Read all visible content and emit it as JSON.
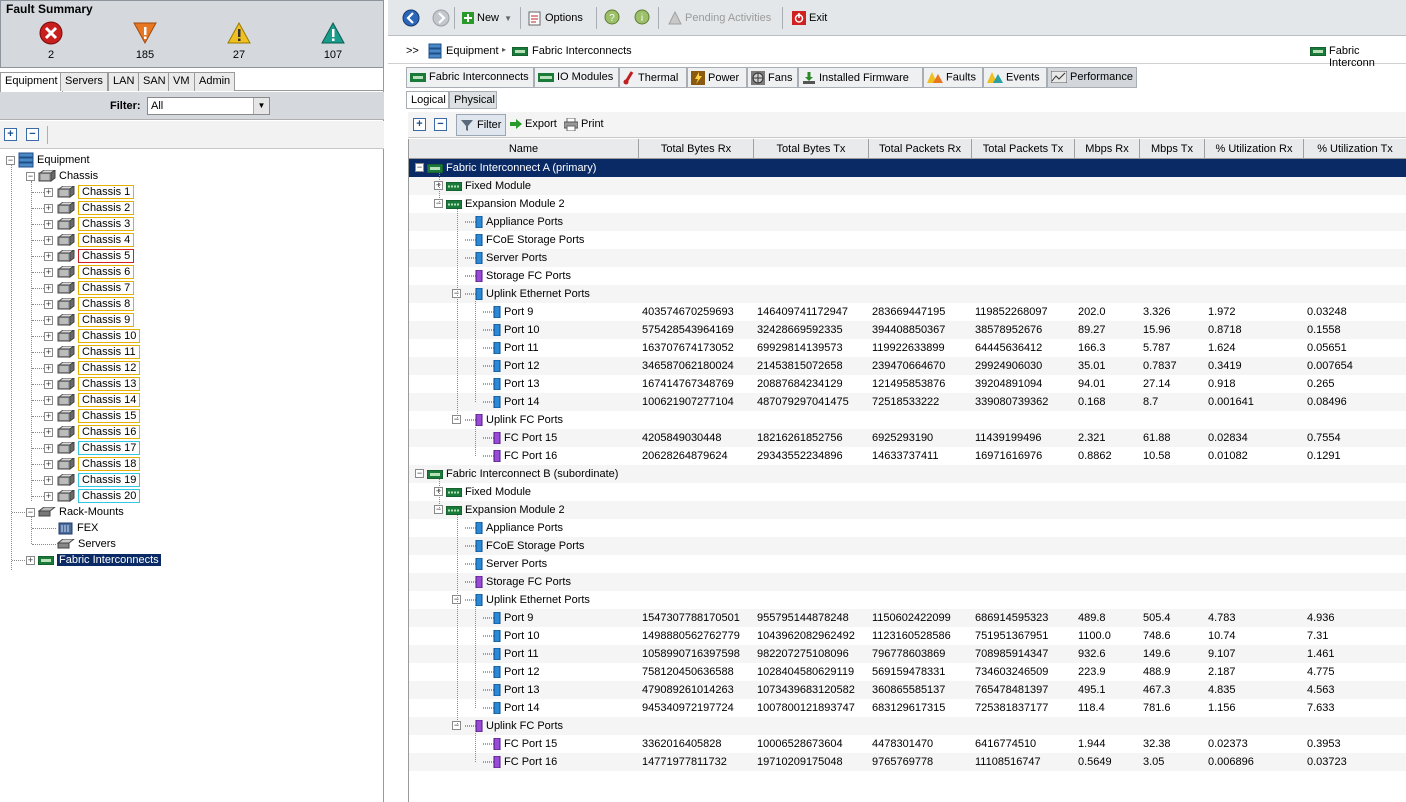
{
  "fault_summary": {
    "title": "Fault Summary",
    "critical": "2",
    "major": "185",
    "minor": "27",
    "warning": "107"
  },
  "nav_tabs": [
    "Equipment",
    "Servers",
    "LAN",
    "SAN",
    "VM",
    "Admin"
  ],
  "filter": {
    "label": "Filter:",
    "value": "All"
  },
  "tree": {
    "root": "Equipment",
    "chassis_label": "Chassis",
    "chassis": [
      "Chassis 1",
      "Chassis 2",
      "Chassis 3",
      "Chassis 4",
      "Chassis 5",
      "Chassis 6",
      "Chassis 7",
      "Chassis 8",
      "Chassis 9",
      "Chassis 10",
      "Chassis 11",
      "Chassis 12",
      "Chassis 13",
      "Chassis 14",
      "Chassis 15",
      "Chassis 16",
      "Chassis 17",
      "Chassis 18",
      "Chassis 19",
      "Chassis 20"
    ],
    "rack_mounts": "Rack-Mounts",
    "fex": "FEX",
    "servers": "Servers",
    "fabric_interconnects": "Fabric Interconnects"
  },
  "toolbar": {
    "new": "New",
    "options": "Options",
    "pending": "Pending Activities",
    "exit": "Exit"
  },
  "breadcrumb": {
    "prefix": ">>",
    "equipment": "Equipment",
    "fabric": "Fabric Interconnects",
    "right": "Fabric Interconn"
  },
  "content_tabs": [
    "Fabric Interconnects",
    "IO Modules",
    "Thermal",
    "Power",
    "Fans",
    "Installed Firmware",
    "Faults",
    "Events",
    "Performance"
  ],
  "view_tabs": [
    "Logical",
    "Physical"
  ],
  "perf_toolbar": {
    "filter": "Filter",
    "export": "Export",
    "print": "Print"
  },
  "columns": [
    "Name",
    "Total Bytes Rx",
    "Total Bytes Tx",
    "Total Packets Rx",
    "Total Packets Tx",
    "Mbps Rx",
    "Mbps Tx",
    "% Utilization Rx",
    "% Utilization Tx"
  ],
  "rows": [
    {
      "level": 0,
      "toggle": "-",
      "icon": "fi",
      "name": "Fabric Interconnect A (primary)",
      "selected": true,
      "values": []
    },
    {
      "level": 1,
      "toggle": "+",
      "icon": "fm",
      "name": "Fixed Module",
      "values": []
    },
    {
      "level": 1,
      "toggle": "-",
      "icon": "fm",
      "name": "Expansion Module 2",
      "values": []
    },
    {
      "level": 2,
      "toggle": "",
      "icon": "port-blue",
      "name": "Appliance Ports",
      "values": []
    },
    {
      "level": 2,
      "toggle": "",
      "icon": "port-blue",
      "name": "FCoE Storage Ports",
      "values": []
    },
    {
      "level": 2,
      "toggle": "",
      "icon": "port-blue",
      "name": "Server Ports",
      "values": []
    },
    {
      "level": 2,
      "toggle": "",
      "icon": "port-purple",
      "name": "Storage FC Ports",
      "values": []
    },
    {
      "level": 2,
      "toggle": "-",
      "icon": "port-blue",
      "name": "Uplink Ethernet Ports",
      "values": []
    },
    {
      "level": 3,
      "toggle": "",
      "icon": "port-blue",
      "name": "Port 9",
      "values": [
        "403574670259693",
        "146409741172947",
        "283669447195",
        "119852268097",
        "202.0",
        "3.326",
        "1.972",
        "0.03248"
      ]
    },
    {
      "level": 3,
      "toggle": "",
      "icon": "port-blue",
      "name": "Port 10",
      "values": [
        "575428543964169",
        "32428669592335",
        "394408850367",
        "38578952676",
        "89.27",
        "15.96",
        "0.8718",
        "0.1558"
      ]
    },
    {
      "level": 3,
      "toggle": "",
      "icon": "port-blue",
      "name": "Port 11",
      "values": [
        "163707674173052",
        "69929814139573",
        "119922633899",
        "64445636412",
        "166.3",
        "5.787",
        "1.624",
        "0.05651"
      ]
    },
    {
      "level": 3,
      "toggle": "",
      "icon": "port-blue",
      "name": "Port 12",
      "values": [
        "346587062180024",
        "21453815072658",
        "239470664670",
        "29924906030",
        "35.01",
        "0.7837",
        "0.3419",
        "0.007654"
      ]
    },
    {
      "level": 3,
      "toggle": "",
      "icon": "port-blue",
      "name": "Port 13",
      "values": [
        "167414767348769",
        "20887684234129",
        "121495853876",
        "39204891094",
        "94.01",
        "27.14",
        "0.918",
        "0.265"
      ]
    },
    {
      "level": 3,
      "toggle": "",
      "icon": "port-blue",
      "name": "Port 14",
      "values": [
        "100621907277104",
        "487079297041475",
        "72518533222",
        "339080739362",
        "0.168",
        "8.7",
        "0.001641",
        "0.08496"
      ]
    },
    {
      "level": 2,
      "toggle": "-",
      "icon": "port-purple",
      "name": "Uplink FC Ports",
      "values": []
    },
    {
      "level": 3,
      "toggle": "",
      "icon": "port-purple",
      "name": "FC Port 15",
      "values": [
        "4205849030448",
        "18216261852756",
        "6925293190",
        "11439199496",
        "2.321",
        "61.88",
        "0.02834",
        "0.7554"
      ]
    },
    {
      "level": 3,
      "toggle": "",
      "icon": "port-purple",
      "name": "FC Port 16",
      "values": [
        "20628264879624",
        "29343552234896",
        "14633737411",
        "16971616976",
        "0.8862",
        "10.58",
        "0.01082",
        "0.1291"
      ]
    },
    {
      "level": 0,
      "toggle": "-",
      "icon": "fi",
      "name": "Fabric Interconnect B (subordinate)",
      "values": []
    },
    {
      "level": 1,
      "toggle": "+",
      "icon": "fm",
      "name": "Fixed Module",
      "values": []
    },
    {
      "level": 1,
      "toggle": "-",
      "icon": "fm",
      "name": "Expansion Module 2",
      "values": []
    },
    {
      "level": 2,
      "toggle": "",
      "icon": "port-blue",
      "name": "Appliance Ports",
      "values": []
    },
    {
      "level": 2,
      "toggle": "",
      "icon": "port-blue",
      "name": "FCoE Storage Ports",
      "values": []
    },
    {
      "level": 2,
      "toggle": "",
      "icon": "port-blue",
      "name": "Server Ports",
      "values": []
    },
    {
      "level": 2,
      "toggle": "",
      "icon": "port-purple",
      "name": "Storage FC Ports",
      "values": []
    },
    {
      "level": 2,
      "toggle": "-",
      "icon": "port-blue",
      "name": "Uplink Ethernet Ports",
      "values": []
    },
    {
      "level": 3,
      "toggle": "",
      "icon": "port-blue",
      "name": "Port 9",
      "values": [
        "1547307788170501",
        "955795144878248",
        "1150602422099",
        "686914595323",
        "489.8",
        "505.4",
        "4.783",
        "4.936"
      ]
    },
    {
      "level": 3,
      "toggle": "",
      "icon": "port-blue",
      "name": "Port 10",
      "values": [
        "1498880562762779",
        "1043962082962492",
        "1123160528586",
        "751951367951",
        "1100.0",
        "748.6",
        "10.74",
        "7.31"
      ]
    },
    {
      "level": 3,
      "toggle": "",
      "icon": "port-blue",
      "name": "Port 11",
      "values": [
        "1058990716397598",
        "982207275108096",
        "796778603869",
        "708985914347",
        "932.6",
        "149.6",
        "9.107",
        "1.461"
      ]
    },
    {
      "level": 3,
      "toggle": "",
      "icon": "port-blue",
      "name": "Port 12",
      "values": [
        "758120450636588",
        "1028404580629119",
        "569159478331",
        "734603246509",
        "223.9",
        "488.9",
        "2.187",
        "4.775"
      ]
    },
    {
      "level": 3,
      "toggle": "",
      "icon": "port-blue",
      "name": "Port 13",
      "values": [
        "479089261014263",
        "1073439683120582",
        "360865585137",
        "765478481397",
        "495.1",
        "467.3",
        "4.835",
        "4.563"
      ]
    },
    {
      "level": 3,
      "toggle": "",
      "icon": "port-blue",
      "name": "Port 14",
      "values": [
        "945340972197724",
        "1007800121893747",
        "683129617315",
        "725381837177",
        "118.4",
        "781.6",
        "1.156",
        "7.633"
      ]
    },
    {
      "level": 2,
      "toggle": "-",
      "icon": "port-purple",
      "name": "Uplink FC Ports",
      "values": []
    },
    {
      "level": 3,
      "toggle": "",
      "icon": "port-purple",
      "name": "FC Port 15",
      "values": [
        "3362016405828",
        "10006528673604",
        "4478301470",
        "6416774510",
        "1.944",
        "32.38",
        "0.02373",
        "0.3953"
      ]
    },
    {
      "level": 3,
      "toggle": "",
      "icon": "port-purple",
      "name": "FC Port 16",
      "values": [
        "14771977811732",
        "19710209175048",
        "9765769778",
        "11108516747",
        "0.5649",
        "3.05",
        "0.006896",
        "0.03723"
      ]
    }
  ],
  "colors": {
    "selection": "#0a2a66",
    "critical": "#d02020",
    "major": "#e87722",
    "minor": "#f0c020",
    "warning": "#1a9c8c"
  }
}
